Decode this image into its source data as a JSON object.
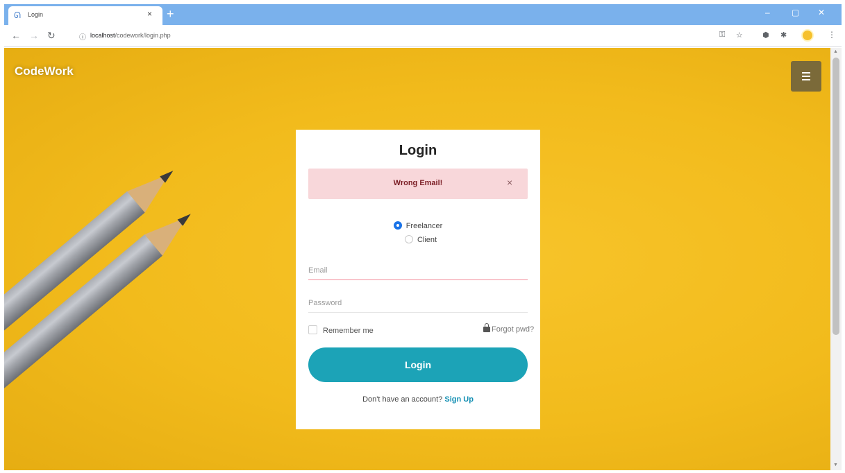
{
  "browser": {
    "tab_title": "Login",
    "tab_close": "×",
    "new_tab": "+",
    "url_host": "localhost",
    "url_path": "/codework/login.php",
    "win_minimize": "–",
    "win_restore": "▢",
    "win_close": "✕"
  },
  "navbar": {
    "brand": "CodeWork"
  },
  "login": {
    "title": "Login",
    "alert_message": "Wrong Email!",
    "alert_close": "×",
    "role_options": [
      {
        "label": "Freelancer",
        "selected": true
      },
      {
        "label": "Client",
        "selected": false
      }
    ],
    "email_placeholder": "Email",
    "email_value": "",
    "password_placeholder": "Password",
    "password_value": "",
    "remember_label": "Remember me",
    "forgot_label": "Forgot pwd?",
    "submit_label": "Login",
    "signup_prompt": "Don't have an account?",
    "signup_link": "Sign Up"
  },
  "colors": {
    "background": "#f2bb1c",
    "button": "#1ca3b7",
    "alert_bg": "#f8d7da",
    "alert_text": "#7a1d24",
    "link": "#138fb3"
  },
  "icons": {
    "favicon": "codework-logo-icon",
    "back": "arrow-left-icon",
    "forward": "arrow-right-icon",
    "reload": "reload-icon",
    "info": "info-icon",
    "key": "key-icon",
    "star": "star-icon",
    "extension": "puzzle-icon",
    "profile": "avatar-icon",
    "menu": "hamburger-icon",
    "lock": "lock-icon"
  }
}
